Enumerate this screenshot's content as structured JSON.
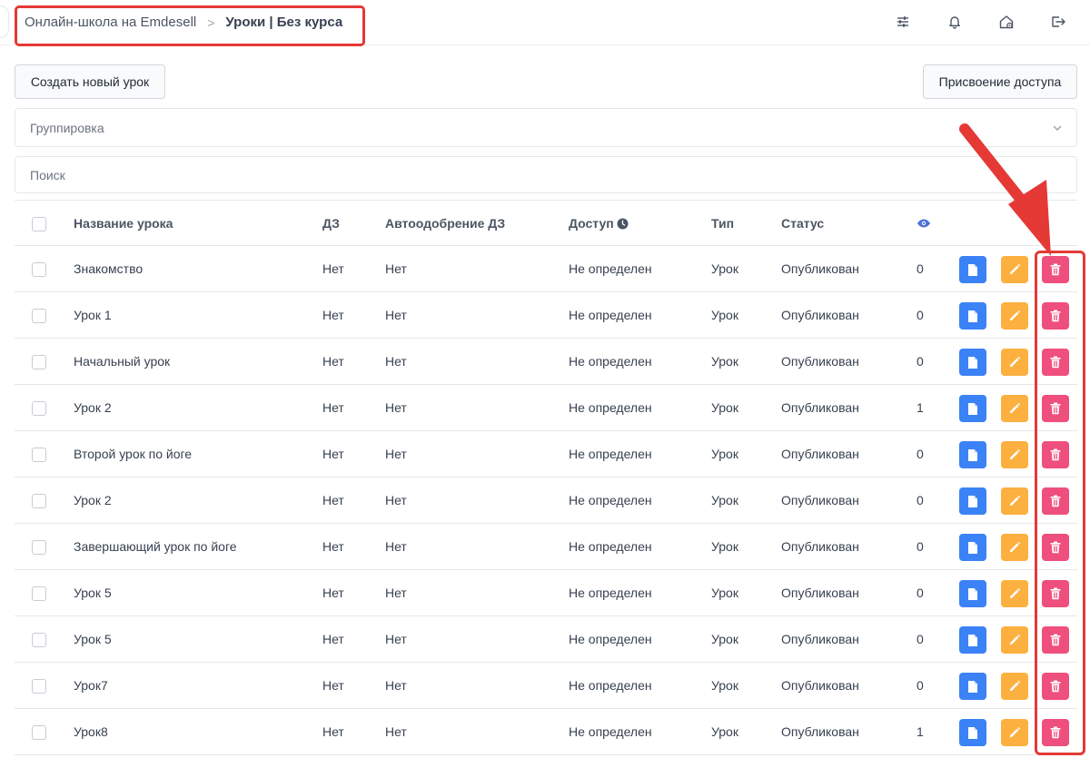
{
  "header": {
    "breadcrumb_root": "Онлайн-школа на Emdesell",
    "breadcrumb_separator": ">",
    "breadcrumb_current": "Уроки | Без курса",
    "icons": [
      "sliders-icon",
      "bell-icon",
      "home-settings-icon",
      "logout-icon"
    ]
  },
  "toolbar": {
    "create_label": "Создать новый урок",
    "access_label": "Присвоение доступа"
  },
  "grouping": {
    "placeholder": "Группировка"
  },
  "search": {
    "placeholder": "Поиск"
  },
  "table": {
    "columns": {
      "name": "Название урока",
      "hw": "ДЗ",
      "auto": "Автоодобрение ДЗ",
      "access": "Доступ",
      "type": "Тип",
      "status": "Статус"
    },
    "rows": [
      {
        "name": "Знакомство",
        "hw": "Нет",
        "auto": "Нет",
        "access": "Не определен",
        "type": "Урок",
        "status": "Опубликован",
        "views": "0"
      },
      {
        "name": "Урок 1",
        "hw": "Нет",
        "auto": "Нет",
        "access": "Не определен",
        "type": "Урок",
        "status": "Опубликован",
        "views": "0"
      },
      {
        "name": "Начальный урок",
        "hw": "Нет",
        "auto": "Нет",
        "access": "Не определен",
        "type": "Урок",
        "status": "Опубликован",
        "views": "0"
      },
      {
        "name": "Урок 2",
        "hw": "Нет",
        "auto": "Нет",
        "access": "Не определен",
        "type": "Урок",
        "status": "Опубликован",
        "views": "1"
      },
      {
        "name": "Второй урок по йоге",
        "hw": "Нет",
        "auto": "Нет",
        "access": "Не определен",
        "type": "Урок",
        "status": "Опубликован",
        "views": "0"
      },
      {
        "name": "Урок 2",
        "hw": "Нет",
        "auto": "Нет",
        "access": "Не определен",
        "type": "Урок",
        "status": "Опубликован",
        "views": "0"
      },
      {
        "name": "Завершающий урок по йоге",
        "hw": "Нет",
        "auto": "Нет",
        "access": "Не определен",
        "type": "Урок",
        "status": "Опубликован",
        "views": "0"
      },
      {
        "name": "Урок 5",
        "hw": "Нет",
        "auto": "Нет",
        "access": "Не определен",
        "type": "Урок",
        "status": "Опубликован",
        "views": "0"
      },
      {
        "name": "Урок 5",
        "hw": "Нет",
        "auto": "Нет",
        "access": "Не определен",
        "type": "Урок",
        "status": "Опубликован",
        "views": "0"
      },
      {
        "name": "Урок7",
        "hw": "Нет",
        "auto": "Нет",
        "access": "Не определен",
        "type": "Урок",
        "status": "Опубликован",
        "views": "0"
      },
      {
        "name": "Урок8",
        "hw": "Нет",
        "auto": "Нет",
        "access": "Не определен",
        "type": "Урок",
        "status": "Опубликован",
        "views": "1"
      }
    ]
  },
  "colors": {
    "view_button": "#3b82f6",
    "edit_button": "#fbb040",
    "delete_button": "#ef4f7c",
    "annotation": "#e53935",
    "eye_icon": "#4a6fd8"
  }
}
